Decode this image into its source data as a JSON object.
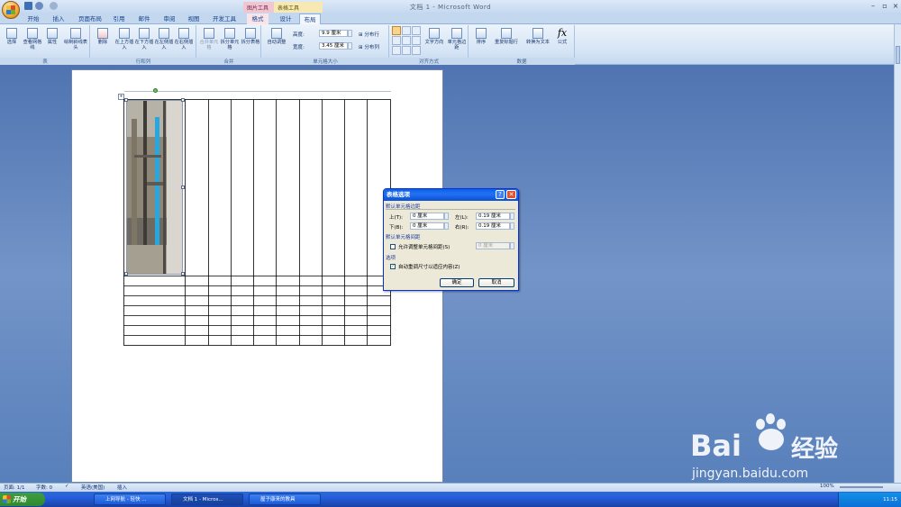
{
  "window": {
    "title": "文档 1 - Microsoft Word",
    "context_tools": [
      "图片工具",
      "表格工具"
    ]
  },
  "tabs": [
    "开始",
    "插入",
    "页面布局",
    "引用",
    "邮件",
    "审阅",
    "视图",
    "开发工具",
    "格式",
    "设计",
    "布局"
  ],
  "ribbon": {
    "groups": [
      {
        "label": "表",
        "buttons": [
          "选择",
          "查看网格线",
          "属性",
          "绘制斜线表头"
        ]
      },
      {
        "label": "行和列",
        "buttons": [
          "删除",
          "在上方插入",
          "在下方插入",
          "在左侧插入",
          "在右侧插入"
        ]
      },
      {
        "label": "合并",
        "buttons": [
          "合并单元格",
          "拆分单元格",
          "拆分表格"
        ]
      },
      {
        "label": "单元格大小",
        "buttons": [
          "自动调整"
        ],
        "height_label": "高度:",
        "height_value": "9.9 厘米",
        "width_label": "宽度:",
        "width_value": "3.45 厘米",
        "dist_rows": "分布行",
        "dist_cols": "分布列"
      },
      {
        "label": "对齐方式",
        "buttons": [
          "文字方向",
          "单元格边距"
        ]
      },
      {
        "label": "数据",
        "buttons": [
          "排序",
          "重复标题行",
          "转换为文本",
          "公式"
        ]
      }
    ]
  },
  "dialog": {
    "title": "表格选项",
    "section_margins": "默认单元格边距",
    "top_label": "上(T):",
    "top_value": "0 厘米",
    "left_label": "左(L):",
    "left_value": "0.19 厘米",
    "bottom_label": "下(B):",
    "bottom_value": "0 厘米",
    "right_label": "右(R):",
    "right_value": "0.19 厘米",
    "section_spacing": "默认单元格间距",
    "allow_spacing_label": "允许调整单元格间距(S)",
    "allow_spacing_checked": false,
    "spacing_value": "0 厘米",
    "section_options": "选项",
    "autoresize_label": "自动重调尺寸以适应内容(Z)",
    "autoresize_checked": true,
    "ok": "确定",
    "cancel": "取消"
  },
  "statusbar": {
    "page": "页面: 1/1",
    "words": "字数: 0",
    "lang": "英语(美国)",
    "mode": "插入",
    "zoom": "100%"
  },
  "taskbar": {
    "start": "开始",
    "items": [
      "上网导航 - 轻快 ...",
      "文档 1 - Micros...",
      "屋子康来的教具"
    ],
    "clock": "11:15"
  },
  "watermark": {
    "brand": "Bai",
    "brand2": "经验",
    "url": "jingyan.baidu.com"
  }
}
